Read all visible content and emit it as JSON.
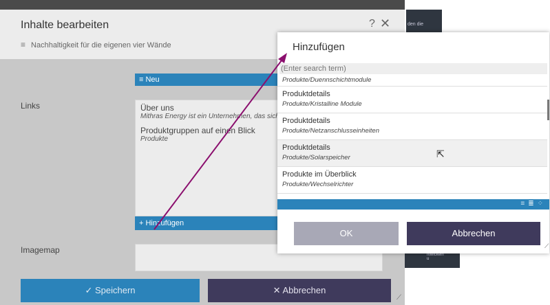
{
  "background": {
    "snippet_top": "den die",
    "snippet_bottom_1": "ntwickeln",
    "snippet_bottom_2": "u"
  },
  "dialog": {
    "title": "Inhalte bearbeiten",
    "help": "?",
    "close": "✕",
    "subtitle": "Nachhaltigkeit für die eigenen vier Wände",
    "subtitle_icon": "≡",
    "neu_button": "Neu",
    "links_label": "Links",
    "links": [
      {
        "title": "Über uns",
        "subtitle": "Mithras Energy ist ein Unternehmen, das sich"
      },
      {
        "title": "Produktgruppen auf einen Blick",
        "subtitle": "Produkte"
      }
    ],
    "add_button": "Hinzufügen",
    "imagemap_label": "Imagemap",
    "save_button": "Speichern",
    "cancel_button": "Abbrechen"
  },
  "popup": {
    "title": "Hinzufügen",
    "search_placeholder": "(Enter search term)",
    "items": [
      {
        "title": "",
        "subtitle": "Produkte/Duennschichtmodule"
      },
      {
        "title": "Produktdetails",
        "subtitle": "Produkte/Kristalline Module"
      },
      {
        "title": "Produktdetails",
        "subtitle": "Produkte/Netzanschlusseinheiten"
      },
      {
        "title": "Produktdetails",
        "subtitle": "Produkte/Solarspeicher"
      },
      {
        "title": "Produkte im Überblick",
        "subtitle": "Produkte/Wechselrichter"
      }
    ],
    "ok_button": "OK",
    "cancel_button": "Abbrechen"
  },
  "colors": {
    "primary": "#2b83ba",
    "dark": "#3f3a5c",
    "annotation_arrow": "#8b0f6e"
  },
  "icons": {
    "subtitle": "lines-icon",
    "neu": "list-icon",
    "add": "plus-icon",
    "save": "check-icon",
    "cancel": "close-icon",
    "view": [
      "list-view-icon",
      "detail-view-icon",
      "grid-view-icon"
    ],
    "cursor": "mouse-pointer-icon"
  }
}
